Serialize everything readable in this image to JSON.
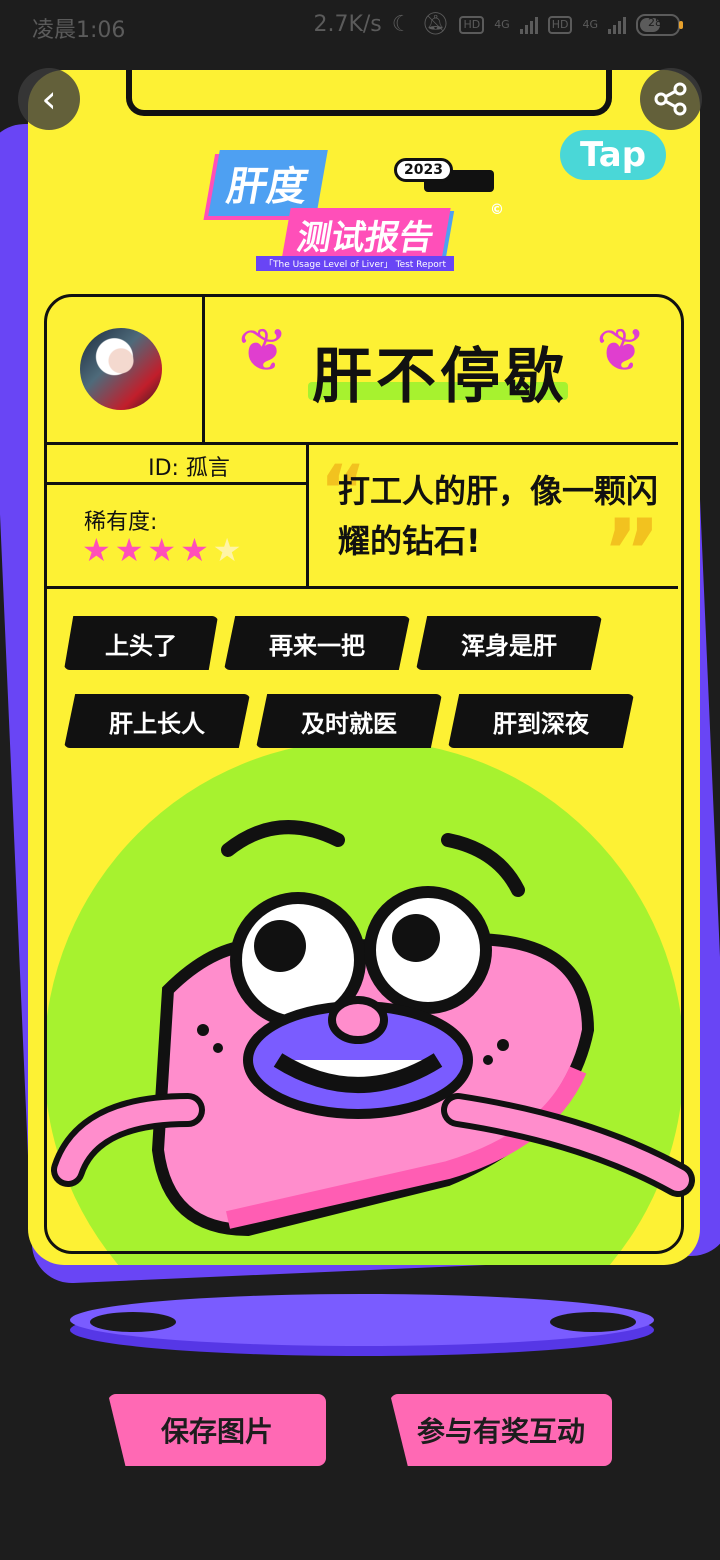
{
  "status_bar": {
    "time": "凌晨1:06",
    "speed": "2.7K/s",
    "network_1": "4G",
    "network_2": "4G",
    "hd_1": "HD",
    "hd_2": "HD",
    "battery": "28"
  },
  "nav": {
    "back_icon": "chevron-left-icon",
    "share_icon": "share-icon"
  },
  "report": {
    "title_top": "肝度",
    "year": "2023",
    "title_bottom": "测试报告",
    "copyright": "©",
    "subtitle": "「The Usage Level of Liver」 Test Report",
    "brand": "Tap"
  },
  "profile": {
    "headline": "肝不停歇",
    "id_label": "ID: 孤言",
    "rarity_label": "稀有度:",
    "rarity_stars": 4,
    "rarity_max": 5,
    "quote": "打工人的肝，像一颗闪耀的钻石!"
  },
  "tags": [
    "上头了",
    "再来一把",
    "浑身是肝",
    "肝上长人",
    "及时就医",
    "肝到深夜"
  ],
  "actions": {
    "save": "保存图片",
    "interact": "参与有奖互动"
  },
  "colors": {
    "card": "#fdf134",
    "accent_pink": "#ff4fb9",
    "accent_purple": "#6945f5",
    "accent_green": "#a7f22f"
  }
}
